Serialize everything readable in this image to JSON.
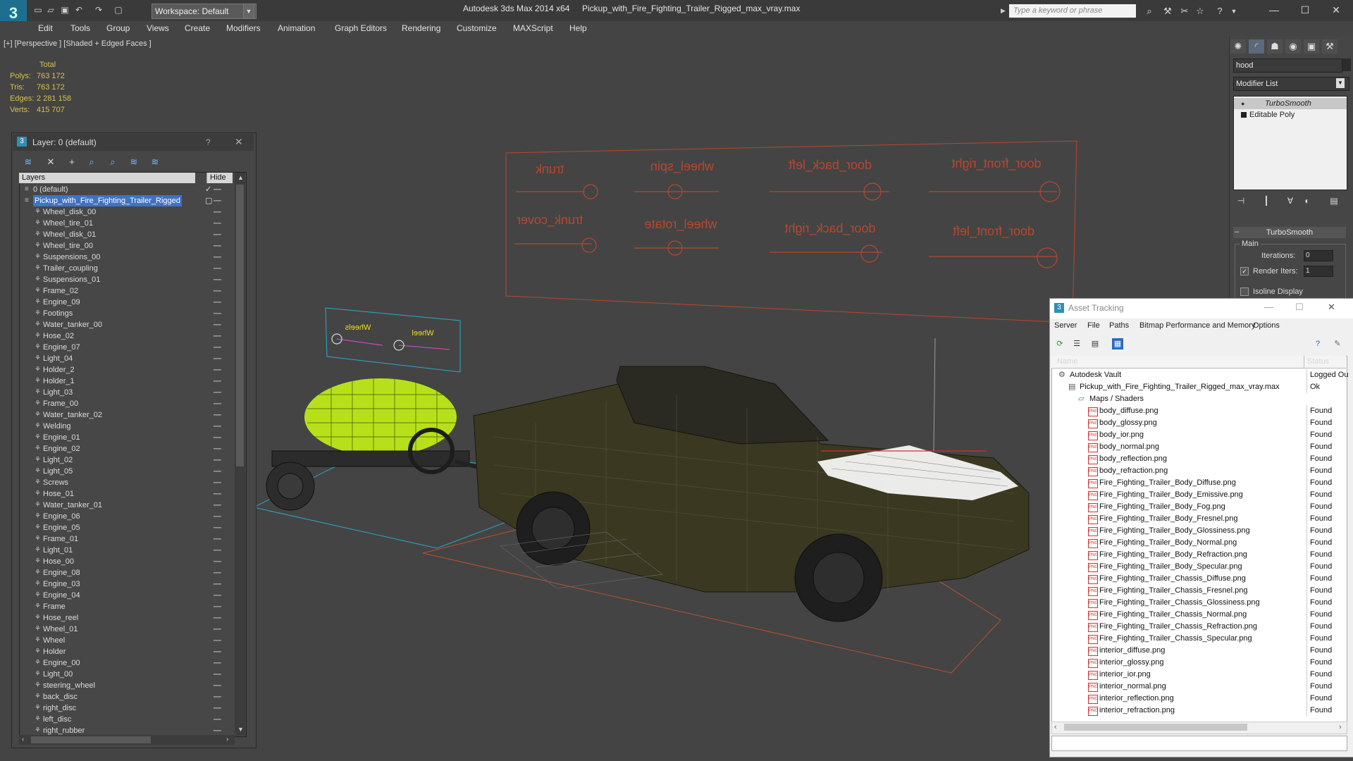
{
  "titlebar": {
    "workspace": "Workspace: Default",
    "app_title": "Autodesk 3ds Max  2014 x64",
    "file_title": "Pickup_with_Fire_Fighting_Trailer_Rigged_max_vray.max",
    "search_placeholder": "Type a keyword or phrase"
  },
  "menu": [
    "Edit",
    "Tools",
    "Group",
    "Views",
    "Create",
    "Modifiers",
    "Animation",
    "Graph Editors",
    "Rendering",
    "Customize",
    "MAXScript",
    "Help"
  ],
  "viewport": {
    "label": "[+] [Perspective ] [Shaded + Edged Faces ]",
    "stats": {
      "header": "Total",
      "rows": [
        {
          "label": "Polys:",
          "value": "763 172"
        },
        {
          "label": "Tris:",
          "value": "763 172"
        },
        {
          "label": "Edges:",
          "value": "2 281 158"
        },
        {
          "label": "Verts:",
          "value": "415 707"
        }
      ]
    },
    "rig_labels": {
      "big": [
        "trunk",
        "wheel_spin",
        "door_back_left",
        "door_front_right",
        "trunk_cover",
        "wheel_rotate",
        "door_back_right",
        "door_front_left"
      ],
      "small": [
        "Wheels",
        "Wheel"
      ]
    },
    "colors": {
      "bg": "#444444",
      "rig_text": "#b8472e",
      "trailer_tank": "#b7e01b",
      "hood_selected": "#ffffff"
    }
  },
  "command_panel": {
    "object_name": "hood",
    "modifier_list": "Modifier List",
    "stack": [
      "TurboSmooth",
      "Editable Poly"
    ],
    "rollout_title": "TurboSmooth",
    "group_main": "Main",
    "iterations_label": "Iterations:",
    "iterations_value": "0",
    "render_iters_label": "Render Iters:",
    "render_iters_value": "1",
    "isoline_label": "Isoline Display"
  },
  "layer_dialog": {
    "title": "Layer: 0 (default)",
    "col_layers": "Layers",
    "col_hide": "Hide",
    "layers": [
      {
        "name": "0 (default)",
        "level": 0,
        "type": "layer"
      },
      {
        "name": "Pickup_with_Fire_Fighting_Trailer_Rigged",
        "level": 0,
        "type": "layer",
        "selected": true
      },
      {
        "name": "Wheel_disk_00",
        "level": 1
      },
      {
        "name": "Wheel_tire_01",
        "level": 1
      },
      {
        "name": "Wheel_disk_01",
        "level": 1
      },
      {
        "name": "Wheel_tire_00",
        "level": 1
      },
      {
        "name": "Suspensions_00",
        "level": 1
      },
      {
        "name": "Trailer_coupling",
        "level": 1
      },
      {
        "name": "Suspensions_01",
        "level": 1
      },
      {
        "name": "Frame_02",
        "level": 1
      },
      {
        "name": "Engine_09",
        "level": 1
      },
      {
        "name": "Footings",
        "level": 1
      },
      {
        "name": "Water_tanker_00",
        "level": 1
      },
      {
        "name": "Hose_02",
        "level": 1
      },
      {
        "name": "Engine_07",
        "level": 1
      },
      {
        "name": "Light_04",
        "level": 1
      },
      {
        "name": "Holder_2",
        "level": 1
      },
      {
        "name": "Holder_1",
        "level": 1
      },
      {
        "name": "Light_03",
        "level": 1
      },
      {
        "name": "Frame_00",
        "level": 1
      },
      {
        "name": "Water_tanker_02",
        "level": 1
      },
      {
        "name": "Welding",
        "level": 1
      },
      {
        "name": "Engine_01",
        "level": 1
      },
      {
        "name": "Engine_02",
        "level": 1
      },
      {
        "name": "Light_02",
        "level": 1
      },
      {
        "name": "Light_05",
        "level": 1
      },
      {
        "name": "Screws",
        "level": 1
      },
      {
        "name": "Hose_01",
        "level": 1
      },
      {
        "name": "Water_tanker_01",
        "level": 1
      },
      {
        "name": "Engine_06",
        "level": 1
      },
      {
        "name": "Engine_05",
        "level": 1
      },
      {
        "name": "Frame_01",
        "level": 1
      },
      {
        "name": "Light_01",
        "level": 1
      },
      {
        "name": "Hose_00",
        "level": 1
      },
      {
        "name": "Engine_08",
        "level": 1
      },
      {
        "name": "Engine_03",
        "level": 1
      },
      {
        "name": "Engine_04",
        "level": 1
      },
      {
        "name": "Frame",
        "level": 1
      },
      {
        "name": "Hose_reel",
        "level": 1
      },
      {
        "name": "Wheel_01",
        "level": 1
      },
      {
        "name": "Wheel",
        "level": 1
      },
      {
        "name": "Holder",
        "level": 1
      },
      {
        "name": "Engine_00",
        "level": 1
      },
      {
        "name": "Light_00",
        "level": 1
      },
      {
        "name": "steering_wheel",
        "level": 1
      },
      {
        "name": "back_disc",
        "level": 1
      },
      {
        "name": "right_disc",
        "level": 1
      },
      {
        "name": "left_disc",
        "level": 1
      },
      {
        "name": "right_rubber",
        "level": 1
      }
    ]
  },
  "asset_tracking": {
    "title": "Asset Tracking",
    "menu": [
      "Server",
      "File",
      "Paths",
      "Bitmap Performance and Memory",
      "Options"
    ],
    "col_name": "Name",
    "col_status": "Status",
    "rows": [
      {
        "name": "Autodesk Vault",
        "status": "Logged Ou",
        "indent": 0,
        "icon": "vault"
      },
      {
        "name": "Pickup_with_Fire_Fighting_Trailer_Rigged_max_vray.max",
        "status": "Ok",
        "indent": 1,
        "icon": "max"
      },
      {
        "name": "Maps / Shaders",
        "status": "",
        "indent": 2,
        "icon": "folder"
      },
      {
        "name": "body_diffuse.png",
        "status": "Found",
        "indent": 3,
        "icon": "png"
      },
      {
        "name": "body_glossy.png",
        "status": "Found",
        "indent": 3,
        "icon": "png"
      },
      {
        "name": "body_ior.png",
        "status": "Found",
        "indent": 3,
        "icon": "png"
      },
      {
        "name": "body_normal.png",
        "status": "Found",
        "indent": 3,
        "icon": "png"
      },
      {
        "name": "body_reflection.png",
        "status": "Found",
        "indent": 3,
        "icon": "png"
      },
      {
        "name": "body_refraction.png",
        "status": "Found",
        "indent": 3,
        "icon": "png"
      },
      {
        "name": "Fire_Fighting_Trailer_Body_Diffuse.png",
        "status": "Found",
        "indent": 3,
        "icon": "png"
      },
      {
        "name": "Fire_Fighting_Trailer_Body_Emissive.png",
        "status": "Found",
        "indent": 3,
        "icon": "png"
      },
      {
        "name": "Fire_Fighting_Trailer_Body_Fog.png",
        "status": "Found",
        "indent": 3,
        "icon": "png"
      },
      {
        "name": "Fire_Fighting_Trailer_Body_Fresnel.png",
        "status": "Found",
        "indent": 3,
        "icon": "png"
      },
      {
        "name": "Fire_Fighting_Trailer_Body_Glossiness.png",
        "status": "Found",
        "indent": 3,
        "icon": "png"
      },
      {
        "name": "Fire_Fighting_Trailer_Body_Normal.png",
        "status": "Found",
        "indent": 3,
        "icon": "png"
      },
      {
        "name": "Fire_Fighting_Trailer_Body_Refraction.png",
        "status": "Found",
        "indent": 3,
        "icon": "png"
      },
      {
        "name": "Fire_Fighting_Trailer_Body_Specular.png",
        "status": "Found",
        "indent": 3,
        "icon": "png"
      },
      {
        "name": "Fire_Fighting_Trailer_Chassis_Diffuse.png",
        "status": "Found",
        "indent": 3,
        "icon": "png"
      },
      {
        "name": "Fire_Fighting_Trailer_Chassis_Fresnel.png",
        "status": "Found",
        "indent": 3,
        "icon": "png"
      },
      {
        "name": "Fire_Fighting_Trailer_Chassis_Glossiness.png",
        "status": "Found",
        "indent": 3,
        "icon": "png"
      },
      {
        "name": "Fire_Fighting_Trailer_Chassis_Normal.png",
        "status": "Found",
        "indent": 3,
        "icon": "png"
      },
      {
        "name": "Fire_Fighting_Trailer_Chassis_Refraction.png",
        "status": "Found",
        "indent": 3,
        "icon": "png"
      },
      {
        "name": "Fire_Fighting_Trailer_Chassis_Specular.png",
        "status": "Found",
        "indent": 3,
        "icon": "png"
      },
      {
        "name": "interior_diffuse.png",
        "status": "Found",
        "indent": 3,
        "icon": "png"
      },
      {
        "name": "interior_glossy.png",
        "status": "Found",
        "indent": 3,
        "icon": "png"
      },
      {
        "name": "interior_ior.png",
        "status": "Found",
        "indent": 3,
        "icon": "png"
      },
      {
        "name": "interior_normal.png",
        "status": "Found",
        "indent": 3,
        "icon": "png"
      },
      {
        "name": "interior_reflection.png",
        "status": "Found",
        "indent": 3,
        "icon": "png"
      },
      {
        "name": "interior_refraction.png",
        "status": "Found",
        "indent": 3,
        "icon": "png"
      }
    ]
  }
}
